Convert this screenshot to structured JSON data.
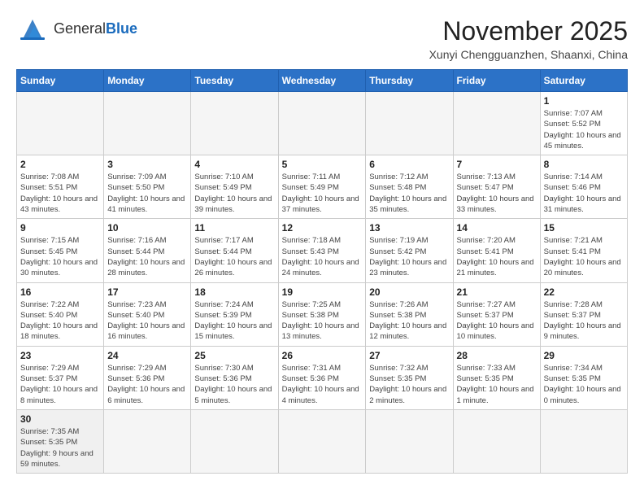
{
  "logo": {
    "text_general": "General",
    "text_blue": "Blue"
  },
  "title": "November 2025",
  "location": "Xunyi Chengguanzhen, Shaanxi, China",
  "days_of_week": [
    "Sunday",
    "Monday",
    "Tuesday",
    "Wednesday",
    "Thursday",
    "Friday",
    "Saturday"
  ],
  "weeks": [
    [
      {
        "day": "",
        "info": ""
      },
      {
        "day": "",
        "info": ""
      },
      {
        "day": "",
        "info": ""
      },
      {
        "day": "",
        "info": ""
      },
      {
        "day": "",
        "info": ""
      },
      {
        "day": "",
        "info": ""
      },
      {
        "day": "1",
        "info": "Sunrise: 7:07 AM\nSunset: 5:52 PM\nDaylight: 10 hours and 45 minutes."
      }
    ],
    [
      {
        "day": "2",
        "info": "Sunrise: 7:08 AM\nSunset: 5:51 PM\nDaylight: 10 hours and 43 minutes."
      },
      {
        "day": "3",
        "info": "Sunrise: 7:09 AM\nSunset: 5:50 PM\nDaylight: 10 hours and 41 minutes."
      },
      {
        "day": "4",
        "info": "Sunrise: 7:10 AM\nSunset: 5:49 PM\nDaylight: 10 hours and 39 minutes."
      },
      {
        "day": "5",
        "info": "Sunrise: 7:11 AM\nSunset: 5:49 PM\nDaylight: 10 hours and 37 minutes."
      },
      {
        "day": "6",
        "info": "Sunrise: 7:12 AM\nSunset: 5:48 PM\nDaylight: 10 hours and 35 minutes."
      },
      {
        "day": "7",
        "info": "Sunrise: 7:13 AM\nSunset: 5:47 PM\nDaylight: 10 hours and 33 minutes."
      },
      {
        "day": "8",
        "info": "Sunrise: 7:14 AM\nSunset: 5:46 PM\nDaylight: 10 hours and 31 minutes."
      }
    ],
    [
      {
        "day": "9",
        "info": "Sunrise: 7:15 AM\nSunset: 5:45 PM\nDaylight: 10 hours and 30 minutes."
      },
      {
        "day": "10",
        "info": "Sunrise: 7:16 AM\nSunset: 5:44 PM\nDaylight: 10 hours and 28 minutes."
      },
      {
        "day": "11",
        "info": "Sunrise: 7:17 AM\nSunset: 5:44 PM\nDaylight: 10 hours and 26 minutes."
      },
      {
        "day": "12",
        "info": "Sunrise: 7:18 AM\nSunset: 5:43 PM\nDaylight: 10 hours and 24 minutes."
      },
      {
        "day": "13",
        "info": "Sunrise: 7:19 AM\nSunset: 5:42 PM\nDaylight: 10 hours and 23 minutes."
      },
      {
        "day": "14",
        "info": "Sunrise: 7:20 AM\nSunset: 5:41 PM\nDaylight: 10 hours and 21 minutes."
      },
      {
        "day": "15",
        "info": "Sunrise: 7:21 AM\nSunset: 5:41 PM\nDaylight: 10 hours and 20 minutes."
      }
    ],
    [
      {
        "day": "16",
        "info": "Sunrise: 7:22 AM\nSunset: 5:40 PM\nDaylight: 10 hours and 18 minutes."
      },
      {
        "day": "17",
        "info": "Sunrise: 7:23 AM\nSunset: 5:40 PM\nDaylight: 10 hours and 16 minutes."
      },
      {
        "day": "18",
        "info": "Sunrise: 7:24 AM\nSunset: 5:39 PM\nDaylight: 10 hours and 15 minutes."
      },
      {
        "day": "19",
        "info": "Sunrise: 7:25 AM\nSunset: 5:38 PM\nDaylight: 10 hours and 13 minutes."
      },
      {
        "day": "20",
        "info": "Sunrise: 7:26 AM\nSunset: 5:38 PM\nDaylight: 10 hours and 12 minutes."
      },
      {
        "day": "21",
        "info": "Sunrise: 7:27 AM\nSunset: 5:37 PM\nDaylight: 10 hours and 10 minutes."
      },
      {
        "day": "22",
        "info": "Sunrise: 7:28 AM\nSunset: 5:37 PM\nDaylight: 10 hours and 9 minutes."
      }
    ],
    [
      {
        "day": "23",
        "info": "Sunrise: 7:29 AM\nSunset: 5:37 PM\nDaylight: 10 hours and 8 minutes."
      },
      {
        "day": "24",
        "info": "Sunrise: 7:29 AM\nSunset: 5:36 PM\nDaylight: 10 hours and 6 minutes."
      },
      {
        "day": "25",
        "info": "Sunrise: 7:30 AM\nSunset: 5:36 PM\nDaylight: 10 hours and 5 minutes."
      },
      {
        "day": "26",
        "info": "Sunrise: 7:31 AM\nSunset: 5:36 PM\nDaylight: 10 hours and 4 minutes."
      },
      {
        "day": "27",
        "info": "Sunrise: 7:32 AM\nSunset: 5:35 PM\nDaylight: 10 hours and 2 minutes."
      },
      {
        "day": "28",
        "info": "Sunrise: 7:33 AM\nSunset: 5:35 PM\nDaylight: 10 hours and 1 minute."
      },
      {
        "day": "29",
        "info": "Sunrise: 7:34 AM\nSunset: 5:35 PM\nDaylight: 10 hours and 0 minutes."
      }
    ],
    [
      {
        "day": "30",
        "info": "Sunrise: 7:35 AM\nSunset: 5:35 PM\nDaylight: 9 hours and 59 minutes."
      },
      {
        "day": "",
        "info": ""
      },
      {
        "day": "",
        "info": ""
      },
      {
        "day": "",
        "info": ""
      },
      {
        "day": "",
        "info": ""
      },
      {
        "day": "",
        "info": ""
      },
      {
        "day": "",
        "info": ""
      }
    ]
  ]
}
